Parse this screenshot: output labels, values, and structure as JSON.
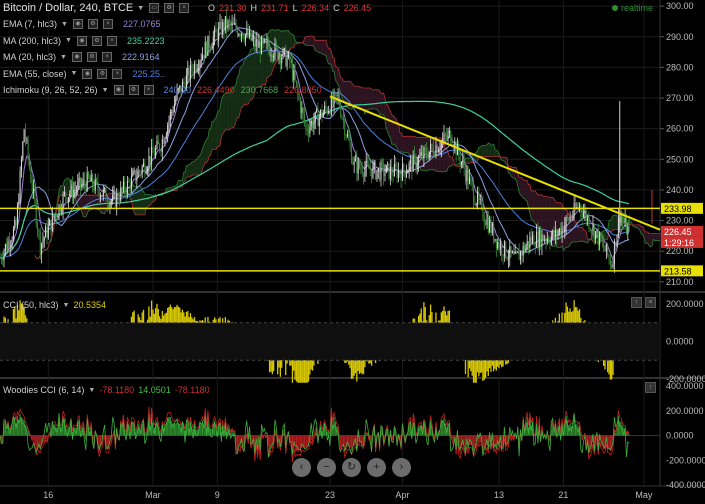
{
  "header": {
    "title": "Bitcoin / Dollar, 240, BTCE",
    "ohlc": [
      {
        "label": "O",
        "value": "231.30"
      },
      {
        "label": "H",
        "value": "231.71"
      },
      {
        "label": "L",
        "value": "226.34"
      },
      {
        "label": "C",
        "value": "226.45"
      }
    ],
    "realtime": "realtime"
  },
  "indicators": [
    {
      "name": "EMA (7, hlc3)",
      "values": [
        "227.0765"
      ],
      "colors": [
        "#9b7fd4"
      ]
    },
    {
      "name": "MA (200, hlc3)",
      "values": [
        "235.2223"
      ],
      "colors": [
        "#3fd0a0"
      ]
    },
    {
      "name": "MA (20, hlc3)",
      "values": [
        "222.9164"
      ],
      "colors": [
        "#8ea0e0"
      ]
    },
    {
      "name": "EMA (55, close)",
      "values": [
        "225.25.."
      ],
      "colors": [
        "#4d7fe0"
      ]
    },
    {
      "name": "Ichimoku (9, 26, 52, 26)",
      "values": [
        "240.00",
        "226.4490",
        "230.7668",
        "226.8050"
      ],
      "colors": [
        "#4a8ae8",
        "#cc3333",
        "#5aa05a",
        "#d03030"
      ]
    }
  ],
  "cci_pane": {
    "name": "CCI (50, hlc3)",
    "value": "20.5354",
    "value_color": "#e0d000"
  },
  "woodies_pane": {
    "name": "Woodies CCI (6, 14)",
    "values": [
      "-78.1180",
      "14.0501",
      "-78.1180"
    ],
    "colors": [
      "#d03030",
      "#40c040",
      "#d03030"
    ]
  },
  "price_axis": {
    "ticks": [
      "300.00",
      "290.00",
      "280.00",
      "270.00",
      "260.00",
      "250.00",
      "240.00",
      "230.00",
      "220.00",
      "210.00"
    ],
    "labels": [
      {
        "text": "233.98",
        "color": "#e8e000",
        "text_color": "#000000"
      },
      {
        "text": "226.45",
        "color": "#d03030",
        "text_color": "#ffffff"
      },
      {
        "text": "1:29:16",
        "color": "#d03030",
        "text_color": "#ffffff"
      },
      {
        "text": "213.58",
        "color": "#e8e000",
        "text_color": "#000000"
      }
    ]
  },
  "cci_axis": {
    "ticks": [
      "200.0000",
      "0.0000",
      "-200.0000"
    ]
  },
  "woodies_axis": {
    "ticks": [
      "400.0000",
      "200.0000",
      "0.0000",
      "-200.0000",
      "-400.0000"
    ]
  },
  "time_axis": {
    "ticks": [
      "16",
      "Mar",
      "9",
      "23",
      "Apr",
      "13",
      "21",
      "May"
    ]
  },
  "nav_buttons": [
    {
      "icon": "chevron-left-icon",
      "glyph": "‹"
    },
    {
      "icon": "minus-icon",
      "glyph": "−"
    },
    {
      "icon": "reset-icon",
      "glyph": "↻"
    },
    {
      "icon": "plus-icon",
      "glyph": "+"
    },
    {
      "icon": "chevron-right-icon",
      "glyph": "›"
    }
  ],
  "chart_data": {
    "type": "candlestick",
    "x_range": [
      "Feb 10",
      "May 3"
    ],
    "ylim": [
      207,
      302
    ],
    "grid": true,
    "close_series": [
      {
        "x": "Feb 10",
        "y": 218
      },
      {
        "x": "Feb 12",
        "y": 228
      },
      {
        "x": "Feb 13",
        "y": 260
      },
      {
        "x": "Feb 15",
        "y": 222
      },
      {
        "x": "Feb 18",
        "y": 238
      },
      {
        "x": "Feb 21",
        "y": 243
      },
      {
        "x": "Feb 24",
        "y": 236
      },
      {
        "x": "Feb 27",
        "y": 245
      },
      {
        "x": "Mar 2",
        "y": 255
      },
      {
        "x": "Mar 4",
        "y": 271
      },
      {
        "x": "Mar 6",
        "y": 280
      },
      {
        "x": "Mar 8",
        "y": 288
      },
      {
        "x": "Mar 10",
        "y": 294
      },
      {
        "x": "Mar 12",
        "y": 292
      },
      {
        "x": "Mar 14",
        "y": 287
      },
      {
        "x": "Mar 16",
        "y": 286
      },
      {
        "x": "Mar 18",
        "y": 282
      },
      {
        "x": "Mar 20",
        "y": 260
      },
      {
        "x": "Mar 22",
        "y": 265
      },
      {
        "x": "Mar 24",
        "y": 270
      },
      {
        "x": "Mar 26",
        "y": 248
      },
      {
        "x": "Mar 29",
        "y": 246
      },
      {
        "x": "Apr 1",
        "y": 246
      },
      {
        "x": "Apr 4",
        "y": 252
      },
      {
        "x": "Apr 7",
        "y": 258
      },
      {
        "x": "Apr 10",
        "y": 238
      },
      {
        "x": "Apr 13",
        "y": 222
      },
      {
        "x": "Apr 15",
        "y": 217
      },
      {
        "x": "Apr 17",
        "y": 224
      },
      {
        "x": "Apr 20",
        "y": 225
      },
      {
        "x": "Apr 23",
        "y": 235
      },
      {
        "x": "Apr 25",
        "y": 226
      },
      {
        "x": "Apr 27",
        "y": 216
      },
      {
        "x": "Apr 28",
        "y": 232
      },
      {
        "x": "Apr 29",
        "y": 226.45
      }
    ],
    "horizontal_lines": [
      233.98,
      213.58
    ],
    "trendline": [
      {
        "x": "Mar 23",
        "y": 270.5
      },
      {
        "x": "May 3",
        "y": 227
      }
    ],
    "last_candle": {
      "x": "Apr 29",
      "open": 231.3,
      "high": 231.71,
      "low": 226.34,
      "close": 226.45
    }
  }
}
